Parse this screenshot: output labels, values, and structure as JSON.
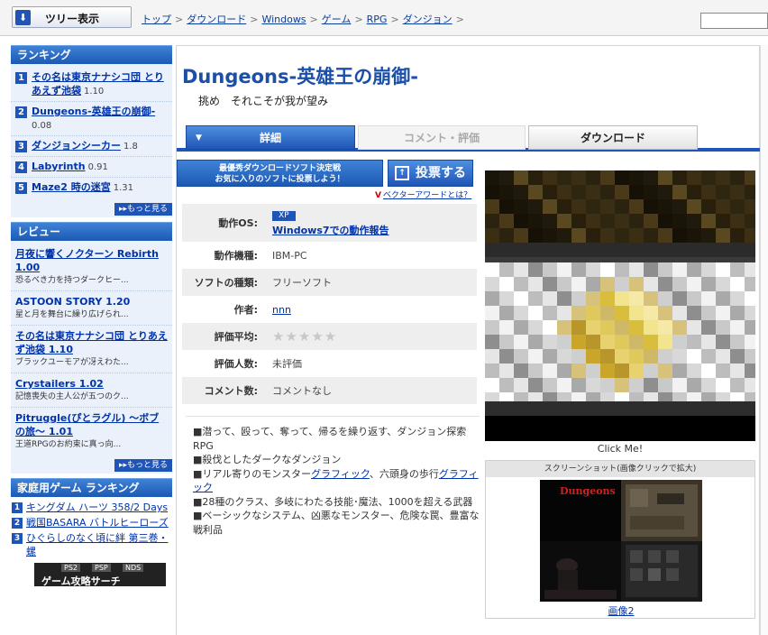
{
  "topbar": {
    "tree_button": "ツリー表示",
    "breadcrumbs": [
      "トップ",
      "ダウンロード",
      "Windows",
      "ゲーム",
      "RPG",
      "ダンジョン"
    ]
  },
  "sidebar": {
    "ranking_title": "ランキング",
    "ranking": [
      {
        "num": "1",
        "name": "その名は東京ナナシコ団 とりあえず池袋",
        "count": "1.10"
      },
      {
        "num": "2",
        "name": "Dungeons-英雄王の崩御-",
        "count": "0.08"
      },
      {
        "num": "3",
        "name": "ダンジョンシーカー",
        "count": "1.8"
      },
      {
        "num": "4",
        "name": "Labyrinth",
        "count": "0.91"
      },
      {
        "num": "5",
        "name": "Maze2 時の迷宮",
        "count": "1.31"
      }
    ],
    "more_label": "もっと見る",
    "review_title": "レビュー",
    "reviews": [
      {
        "title": "月夜に響くノクターン Rebirth 1.00",
        "sub": "恐るべき力を持つダークヒー..."
      },
      {
        "title": "ASTOON STORY 1.20",
        "sub": "星と月を舞台に繰り広げられ..."
      },
      {
        "title": "その名は東京ナナシコ団 とりあえず池袋 1.10",
        "sub": "ブラックユーモアが冴えわた..."
      },
      {
        "title": "Crystailers 1.02",
        "sub": "記憶喪失の主人公が五つのク..."
      },
      {
        "title": "Pitruggle(ぴとラグル) ～ボブの旅～ 1.01",
        "sub": "王道RPGのお約束に真っ向..."
      }
    ],
    "home_title": "家庭用ゲーム ランキング",
    "home_ranking": [
      {
        "num": "1",
        "name": "キングダム ハーツ 358/2 Days"
      },
      {
        "num": "2",
        "name": "戦国BASARA バトルヒーローズ"
      },
      {
        "num": "3",
        "name": "ひぐらしのなく頃に絆 第三巻・螺"
      }
    ],
    "banner": {
      "tags": [
        "PS2",
        "PSP",
        "NDS"
      ],
      "text": "ゲーム攻略サーチ"
    }
  },
  "main": {
    "title": "Dungeons-英雄王の崩御-",
    "subtitle": "挑め　それこそが我が望み",
    "tabs": {
      "detail": "詳細",
      "comment": "コメント・評価",
      "download": "ダウンロード"
    },
    "award_button": [
      "最優秀ダウンロードソフト決定戦",
      "お気に入りのソフトに投票しよう！"
    ],
    "vote_button": "投票する",
    "vector_award": "ベクターアワードとは？",
    "spec": {
      "os_label": "動作OS:",
      "os_badge": "XP",
      "os_report": "Windows7での動作報告",
      "machine_label": "動作機種:",
      "machine": "IBM-PC",
      "type_label": "ソフトの種類:",
      "type": "フリーソフト",
      "author_label": "作者:",
      "author": "nnn",
      "rating_label": "評価平均:",
      "rating_stars": "★★★★★",
      "raters_label": "評価人数:",
      "raters": "未評価",
      "comments_label": "コメント数:",
      "comments": "コメントなし"
    },
    "description": [
      "■潜って、殴って、奪って、帰るを繰り返す、ダンジョン探索RPG",
      "■殺伐としたダークなダンジョン",
      "■リアル寄りのモンスター",
      "グラフィック",
      "、六頭身の歩行",
      "グラフィック",
      "■28種のクラス、多岐にわたる技能･魔法、1000を超える武器",
      "■ベーシックなシステム、凶悪なモンスター、危険な罠、豊富な戦利品"
    ],
    "click_me": "Click Me!",
    "screenshot_header": "スクリーンショット(画像クリックで拡大)",
    "thumb_title": "Dungeons",
    "thumb_link": "画像2"
  }
}
